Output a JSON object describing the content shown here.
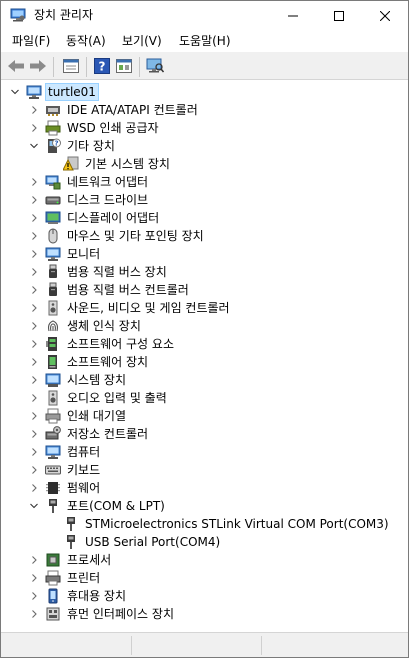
{
  "window": {
    "title": "장치 관리자",
    "icon": "device-manager-icon",
    "controls": [
      "minimize-icon",
      "maximize-icon",
      "close-icon"
    ]
  },
  "menu": [
    {
      "label": "파일(F)"
    },
    {
      "label": "동작(A)"
    },
    {
      "label": "보기(V)"
    },
    {
      "label": "도움말(H)"
    }
  ],
  "toolbar": [
    {
      "icon": "back-arrow-icon"
    },
    {
      "icon": "forward-arrow-icon"
    },
    {
      "icon": "properties-icon"
    },
    {
      "icon": "help-icon"
    },
    {
      "icon": "update-driver-icon"
    },
    {
      "icon": "scan-hardware-icon"
    }
  ],
  "tree": {
    "root": {
      "label": "turtle01",
      "icon": "computer-icon",
      "expanded": true
    },
    "nodes": [
      {
        "label": "IDE ATA/ATAPI 컨트롤러",
        "icon": "ide-controller-icon",
        "expanded": false
      },
      {
        "label": "WSD 인쇄 공급자",
        "icon": "printer-provider-icon",
        "expanded": false
      },
      {
        "label": "기타 장치",
        "icon": "unknown-device-icon",
        "expanded": true,
        "children": [
          {
            "label": "기본 시스템 장치",
            "icon": "warning-device-icon"
          }
        ]
      },
      {
        "label": "네트워크 어댑터",
        "icon": "network-adapter-icon",
        "expanded": false
      },
      {
        "label": "디스크 드라이브",
        "icon": "disk-drive-icon",
        "expanded": false
      },
      {
        "label": "디스플레이 어댑터",
        "icon": "display-adapter-icon",
        "expanded": false
      },
      {
        "label": "마우스 및 기타 포인팅 장치",
        "icon": "mouse-icon",
        "expanded": false
      },
      {
        "label": "모니터",
        "icon": "monitor-icon",
        "expanded": false
      },
      {
        "label": "범용 직렬 버스 장치",
        "icon": "usb-icon",
        "expanded": false
      },
      {
        "label": "범용 직렬 버스 컨트롤러",
        "icon": "usb-icon",
        "expanded": false
      },
      {
        "label": "사운드, 비디오 및 게임 컨트롤러",
        "icon": "speaker-icon",
        "expanded": false
      },
      {
        "label": "생체 인식 장치",
        "icon": "fingerprint-icon",
        "expanded": false
      },
      {
        "label": "소프트웨어 구성 요소",
        "icon": "software-component-icon",
        "expanded": false
      },
      {
        "label": "소프트웨어 장치",
        "icon": "software-device-icon",
        "expanded": false
      },
      {
        "label": "시스템 장치",
        "icon": "system-device-icon",
        "expanded": false
      },
      {
        "label": "오디오 입력 및 출력",
        "icon": "speaker-icon",
        "expanded": false
      },
      {
        "label": "인쇄 대기열",
        "icon": "print-queue-icon",
        "expanded": false
      },
      {
        "label": "저장소 컨트롤러",
        "icon": "storage-controller-icon",
        "expanded": false
      },
      {
        "label": "컴퓨터",
        "icon": "monitor-icon",
        "expanded": false
      },
      {
        "label": "키보드",
        "icon": "keyboard-icon",
        "expanded": false
      },
      {
        "label": "펌웨어",
        "icon": "firmware-icon",
        "expanded": false
      },
      {
        "label": "포트(COM & LPT)",
        "icon": "port-icon",
        "expanded": true,
        "children": [
          {
            "label": "STMicroelectronics STLink Virtual COM Port(COM3)",
            "icon": "port-icon"
          },
          {
            "label": "USB Serial Port(COM4)",
            "icon": "port-icon"
          }
        ]
      },
      {
        "label": "프로세서",
        "icon": "processor-icon",
        "expanded": false
      },
      {
        "label": "프린터",
        "icon": "printer-icon",
        "expanded": false
      },
      {
        "label": "휴대용 장치",
        "icon": "portable-device-icon",
        "expanded": false
      },
      {
        "label": "휴먼 인터페이스 장치",
        "icon": "hid-icon",
        "expanded": false
      }
    ]
  },
  "colors": {
    "selection_bg": "#cce8ff",
    "selection_border": "#99d1ff",
    "toolbar_bg": "#f0f0f0"
  }
}
